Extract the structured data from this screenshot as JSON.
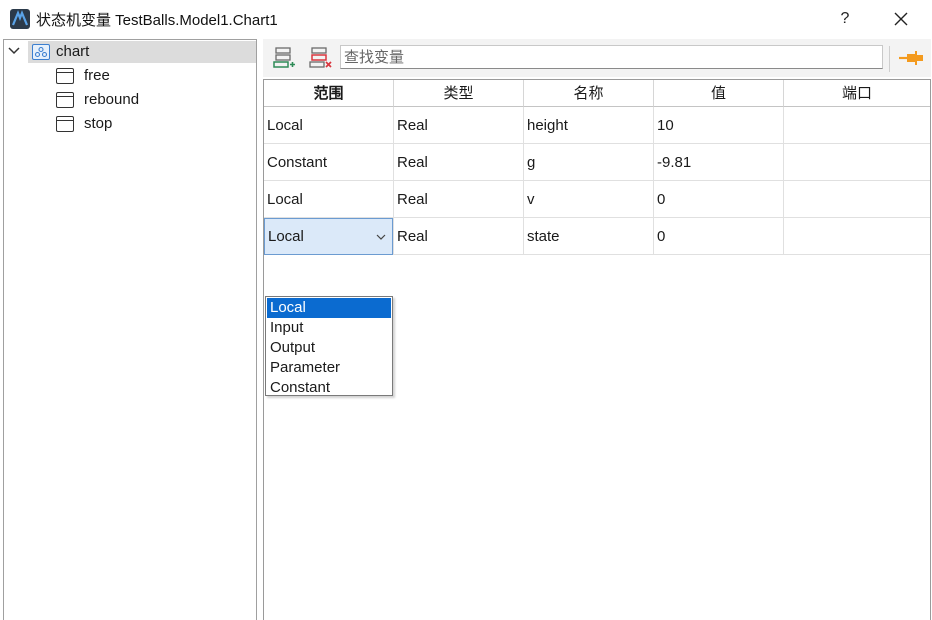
{
  "window": {
    "title": "状态机变量 TestBalls.Model1.Chart1",
    "help_label": "?",
    "close_label": "✕"
  },
  "tree": {
    "root": {
      "label": "chart",
      "icon": "chart-icon",
      "expanded": true
    },
    "children": [
      {
        "label": "free",
        "icon": "state-icon"
      },
      {
        "label": "rebound",
        "icon": "state-icon"
      },
      {
        "label": "stop",
        "icon": "state-icon"
      }
    ]
  },
  "toolbar": {
    "add_icon": "add-variable-icon",
    "delete_icon": "delete-variable-icon",
    "search_placeholder": "查找变量",
    "search_value": "",
    "pin_icon": "pin-icon"
  },
  "table": {
    "headers": [
      "范围",
      "类型",
      "名称",
      "值",
      "端口"
    ],
    "rows": [
      [
        "Local",
        "Real",
        "height",
        "10",
        ""
      ],
      [
        "Constant",
        "Real",
        "g",
        "-9.81",
        ""
      ],
      [
        "Local",
        "Real",
        "v",
        "0",
        ""
      ],
      [
        "Local",
        "Real",
        "state",
        "0",
        ""
      ]
    ]
  },
  "scope_dropdown": {
    "selected": "Local",
    "options": [
      "Local",
      "Input",
      "Output",
      "Parameter",
      "Constant"
    ]
  },
  "colors": {
    "selection": "#0b6bd0",
    "combo_bg": "#dbe9f9",
    "pin": "#f39a1e"
  }
}
